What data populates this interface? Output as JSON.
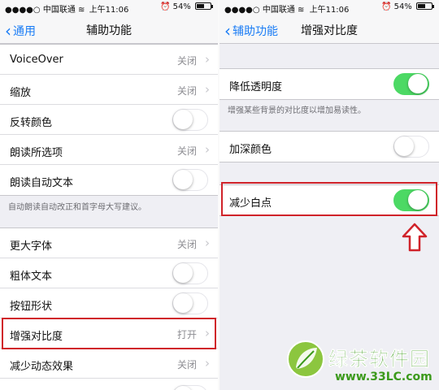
{
  "left_screen": {
    "status": {
      "carrier": "中国联通",
      "time": "上午11:06",
      "battery": "54%"
    },
    "nav": {
      "back_label": "通用",
      "title": "辅助功能"
    },
    "group1": [
      {
        "label": "VoiceOver",
        "value": "关闭",
        "kind": "detail"
      },
      {
        "label": "缩放",
        "value": "关闭",
        "kind": "detail"
      },
      {
        "label": "反转颜色",
        "kind": "toggle",
        "on": false
      },
      {
        "label": "朗读所选项",
        "value": "关闭",
        "kind": "detail"
      },
      {
        "label": "朗读自动文本",
        "kind": "toggle",
        "on": false
      }
    ],
    "group1_footnote": "自动朗读自动改正和首字母大写建议。",
    "group2": [
      {
        "label": "更大字体",
        "value": "关闭",
        "kind": "detail"
      },
      {
        "label": "粗体文本",
        "kind": "toggle",
        "on": false
      },
      {
        "label": "按钮形状",
        "kind": "toggle",
        "on": false
      },
      {
        "label": "增强对比度",
        "value": "打开",
        "kind": "detail"
      },
      {
        "label": "减少动态效果",
        "value": "关闭",
        "kind": "detail"
      }
    ]
  },
  "right_screen": {
    "status": {
      "carrier": "中国联通",
      "time": "上午11:06",
      "battery": "54%"
    },
    "nav": {
      "back_label": "辅助功能",
      "title": "增强对比度"
    },
    "group1": [
      {
        "label": "降低透明度",
        "kind": "toggle",
        "on": true
      }
    ],
    "group1_footnote": "增强某些背景的对比度以增加易读性。",
    "group2": [
      {
        "label": "加深颜色",
        "kind": "toggle",
        "on": false
      }
    ],
    "group3": [
      {
        "label": "减少白点",
        "kind": "toggle",
        "on": true
      }
    ]
  },
  "watermark": {
    "name": "绿茶软件园",
    "url": "www.33LC.com"
  },
  "colors": {
    "accent": "#1a7cf5",
    "toggle_on": "#4cd964",
    "highlight": "#d0232a",
    "brand_green": "#3c9a1c"
  },
  "icons": {
    "back": "chevron-left-icon",
    "disclosure": "chevron-right-icon",
    "arrow": "up-arrow-icon",
    "wifi": "wifi-icon",
    "alarm": "alarm-icon"
  }
}
